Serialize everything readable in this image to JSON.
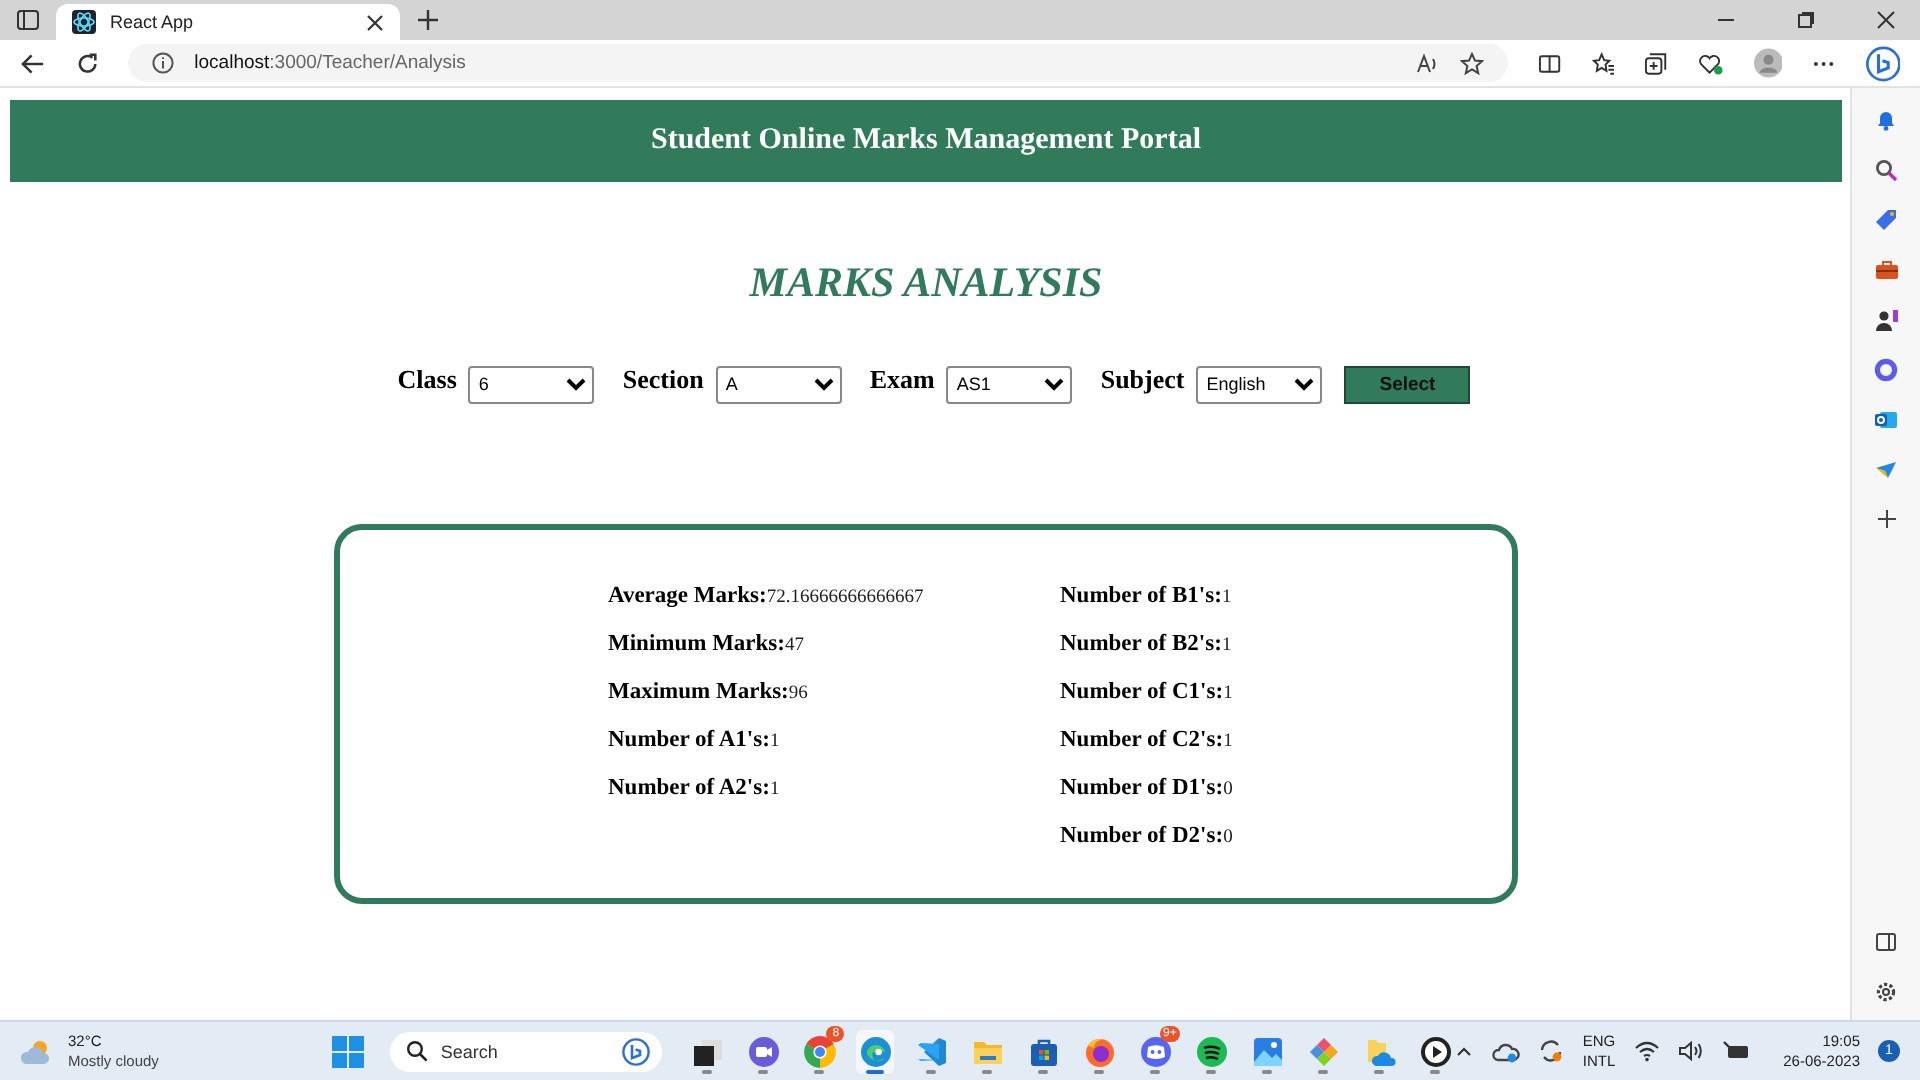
{
  "browser": {
    "tab_title": "React App",
    "address_host": "localhost",
    "address_path": ":3000/Teacher/Analysis"
  },
  "header": {
    "title": "Student Online Marks Management Portal"
  },
  "page_title": "MARKS ANALYSIS",
  "filters": [
    {
      "label": "Class",
      "value": "6"
    },
    {
      "label": "Section",
      "value": "A"
    },
    {
      "label": "Exam",
      "value": "AS1"
    },
    {
      "label": "Subject",
      "value": "English"
    }
  ],
  "select_button": "Select",
  "stats": {
    "left": [
      {
        "label": "Average Marks:",
        "value": "72.16666666666667"
      },
      {
        "label": "Minimum Marks:",
        "value": "47"
      },
      {
        "label": "Maximum Marks:",
        "value": "96"
      },
      {
        "label": "Number of A1's:",
        "value": "1"
      },
      {
        "label": "Number of A2's:",
        "value": "1"
      }
    ],
    "right": [
      {
        "label": "Number of B1's:",
        "value": "1"
      },
      {
        "label": "Number of B2's:",
        "value": "1"
      },
      {
        "label": "Number of C1's:",
        "value": "1"
      },
      {
        "label": "Number of C2's:",
        "value": "1"
      },
      {
        "label": "Number of D1's:",
        "value": "0"
      },
      {
        "label": "Number of D2's:",
        "value": "0"
      }
    ]
  },
  "taskbar": {
    "weather": {
      "temp": "32°C",
      "text": "Mostly cloudy"
    },
    "search_placeholder": "Search",
    "apps": [
      {
        "kind": "taskview",
        "selected": false
      },
      {
        "kind": "chat",
        "selected": false
      },
      {
        "kind": "chrome",
        "selected": false,
        "badge": "8"
      },
      {
        "kind": "edge",
        "selected": true
      },
      {
        "kind": "vscode",
        "selected": false
      },
      {
        "kind": "files",
        "selected": false
      },
      {
        "kind": "store",
        "selected": false
      },
      {
        "kind": "firefox",
        "selected": false
      },
      {
        "kind": "discord",
        "selected": false,
        "badge": "9+"
      },
      {
        "kind": "spotify",
        "selected": false
      },
      {
        "kind": "photos",
        "selected": false
      },
      {
        "kind": "git",
        "selected": false
      },
      {
        "kind": "onedrive",
        "selected": false
      },
      {
        "kind": "player",
        "selected": false
      }
    ],
    "language": [
      "ENG",
      "INTL"
    ],
    "time": "19:05",
    "date": "26-06-2023",
    "notifications": "1"
  }
}
